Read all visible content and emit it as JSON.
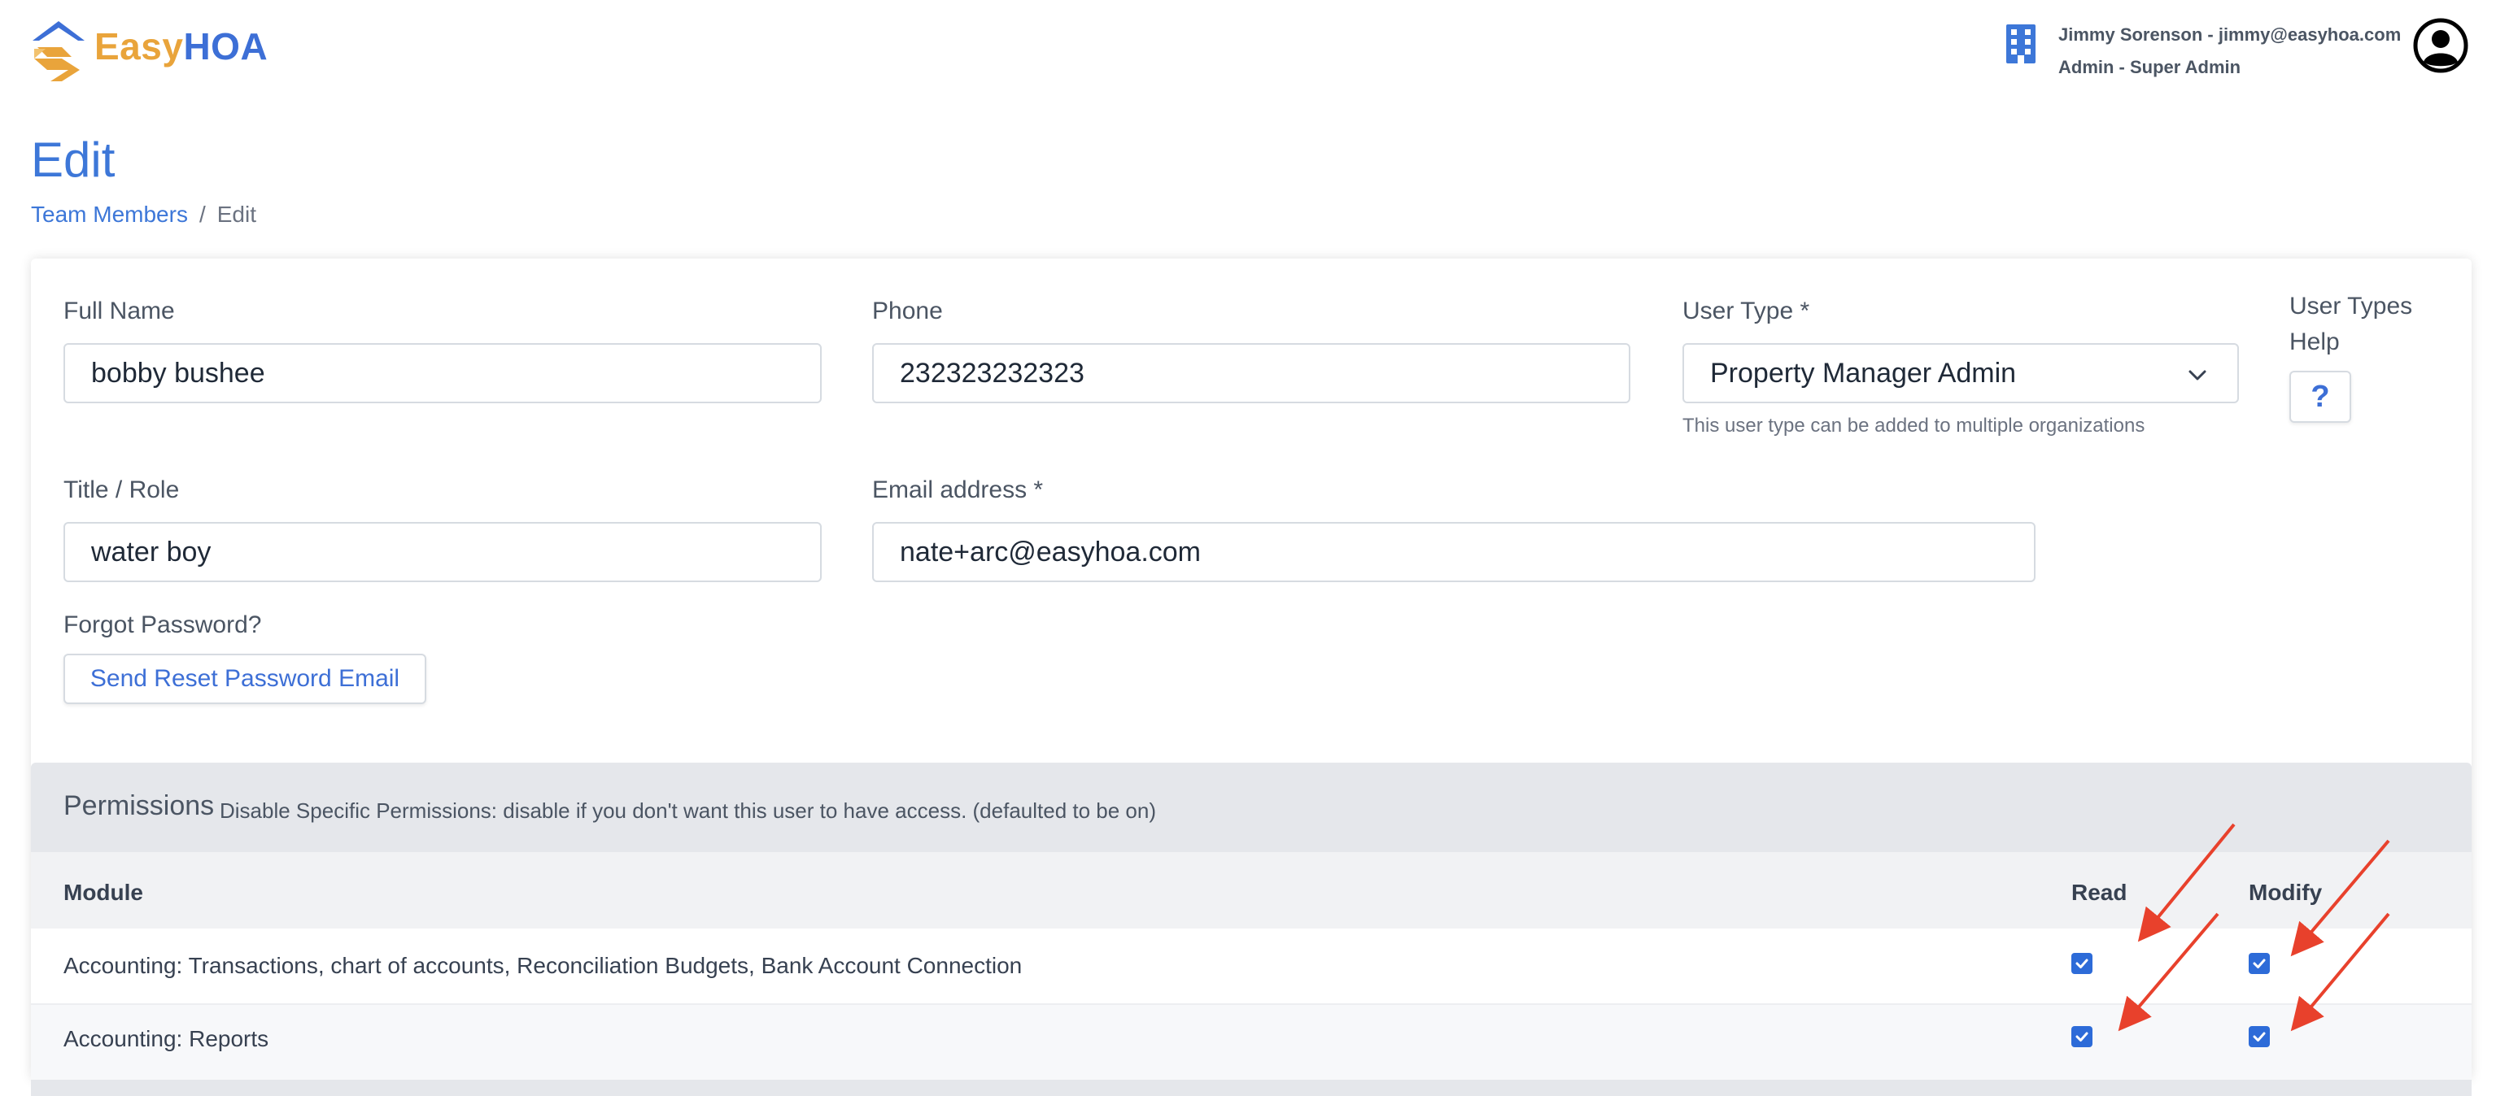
{
  "header": {
    "logo_easy": "Easy",
    "logo_hoa": "HOA",
    "user_line1": "Jimmy Sorenson - jimmy@easyhoa.com",
    "user_line2": "Admin - Super Admin",
    "icons": {
      "org": "building-icon",
      "avatar": "user-avatar-icon"
    }
  },
  "page": {
    "title": "Edit",
    "breadcrumb": {
      "parent": "Team Members",
      "separator": "/",
      "current": "Edit"
    }
  },
  "form": {
    "full_name": {
      "label": "Full Name",
      "value": "bobby bushee"
    },
    "phone": {
      "label": "Phone",
      "value": "232323232323"
    },
    "user_type": {
      "label": "User Type *",
      "value": "Property Manager Admin",
      "hint": "This user type can be added to multiple organizations"
    },
    "user_types_help": {
      "label_line1": "User Types",
      "label_line2": "Help",
      "button": "?"
    },
    "title_role": {
      "label": "Title / Role",
      "value": "water boy"
    },
    "email": {
      "label": "Email address *",
      "value": "nate+arc@easyhoa.com"
    },
    "forgot_password": {
      "label": "Forgot Password?",
      "button": "Send Reset Password Email"
    }
  },
  "permissions": {
    "title": "Permissions",
    "description": "Disable Specific Permissions: disable if you don't want this user to have access. (defaulted to be on)",
    "columns": {
      "module": "Module",
      "read": "Read",
      "modify": "Modify"
    },
    "rows": [
      {
        "module": "Accounting: Transactions, chart of accounts, Reconciliation Budgets, Bank Account Connection",
        "read": true,
        "modify": true
      },
      {
        "module": "Accounting: Reports",
        "read": true,
        "modify": true
      }
    ]
  },
  "colors": {
    "accent_blue": "#3d77d8",
    "logo_orange": "#e9a43b",
    "checkbox_blue": "#2d6bd8",
    "annotation_red": "#e8412c"
  }
}
